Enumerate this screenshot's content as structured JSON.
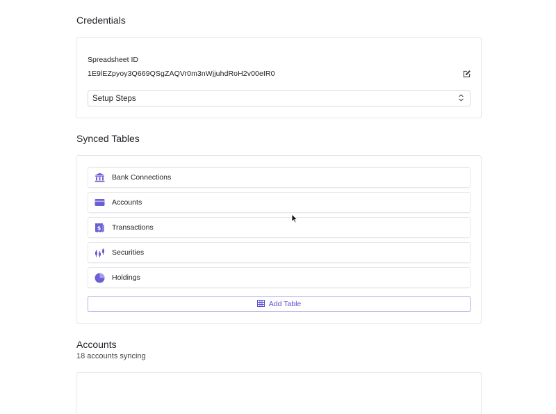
{
  "credentials": {
    "title": "Credentials",
    "spreadsheet_label": "Spreadsheet ID",
    "spreadsheet_id": "1E9lEZpyoy3Q669QSgZAQVr0m3nWjjuhdRoH2v00eIR0",
    "setup_select": "Setup Steps"
  },
  "synced_tables": {
    "title": "Synced Tables",
    "items": [
      {
        "label": "Bank Connections",
        "icon": "bank-icon"
      },
      {
        "label": "Accounts",
        "icon": "credit-card-icon"
      },
      {
        "label": "Transactions",
        "icon": "receipt-dollar-icon"
      },
      {
        "label": "Securities",
        "icon": "candlestick-icon"
      },
      {
        "label": "Holdings",
        "icon": "pie-chart-icon"
      }
    ],
    "add_label": "Add Table"
  },
  "accounts": {
    "title": "Accounts",
    "subtitle": "18 accounts syncing"
  },
  "colors": {
    "accent": "#6b5fd3",
    "accent_text": "#5b4fcf",
    "border": "#e6e6ea"
  }
}
